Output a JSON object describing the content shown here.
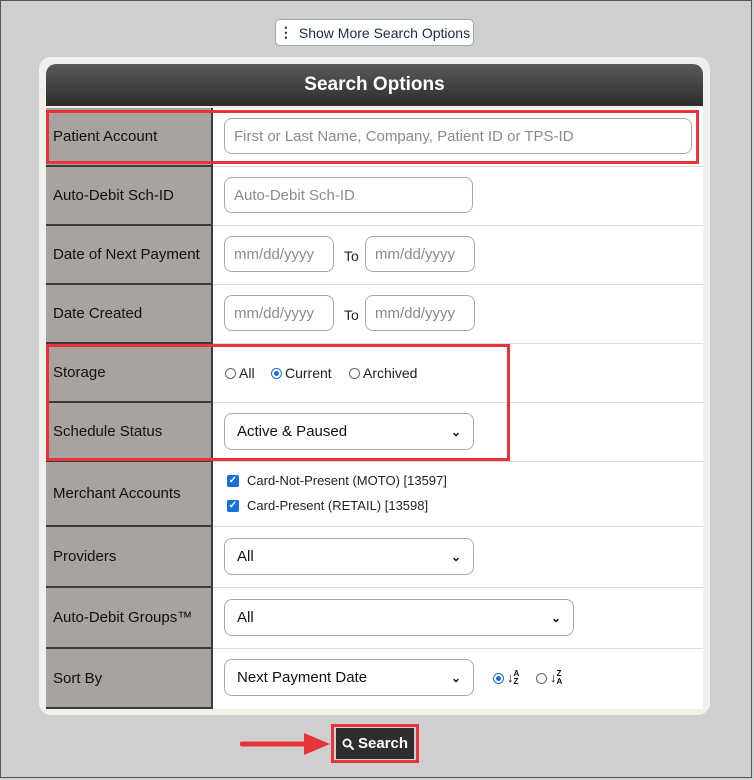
{
  "toolbar": {
    "more_label": "Show More Search Options"
  },
  "panel": {
    "title": "Search Options"
  },
  "rows": {
    "patient_account": {
      "label": "Patient Account",
      "placeholder": "First or Last Name, Company, Patient ID or TPS-ID"
    },
    "auto_debit_id": {
      "label": "Auto-Debit Sch-ID",
      "placeholder": "Auto-Debit Sch-ID"
    },
    "next_payment": {
      "label": "Date of Next Payment",
      "from_placeholder": "mm/dd/yyyy",
      "to_label": "To",
      "to_placeholder": "mm/dd/yyyy"
    },
    "date_created": {
      "label": "Date Created",
      "from_placeholder": "mm/dd/yyyy",
      "to_label": "To",
      "to_placeholder": "mm/dd/yyyy"
    },
    "storage": {
      "label": "Storage",
      "options": [
        "All",
        "Current",
        "Archived"
      ],
      "selected": "Current"
    },
    "schedule_status": {
      "label": "Schedule Status",
      "value": "Active & Paused"
    },
    "merchant_accounts": {
      "label": "Merchant Accounts",
      "items": [
        "Card-Not-Present (MOTO) [13597]",
        "Card-Present (RETAIL) [13598]"
      ]
    },
    "providers": {
      "label": "Providers",
      "value": "All"
    },
    "groups": {
      "label": "Auto-Debit Groups™",
      "value": "All"
    },
    "sort_by": {
      "label": "Sort By",
      "value": "Next Payment Date",
      "order_selected": "ascending"
    }
  },
  "actions": {
    "search_label": "Search"
  },
  "colors": {
    "highlight": "#e8333a",
    "accent": "#1a6fd8",
    "label_bg": "#a7a39e"
  },
  "icons": {
    "more": "vertical-dots-icon",
    "search": "magnifier-icon",
    "sort_asc": "sort-az-icon",
    "sort_desc": "sort-za-icon"
  }
}
